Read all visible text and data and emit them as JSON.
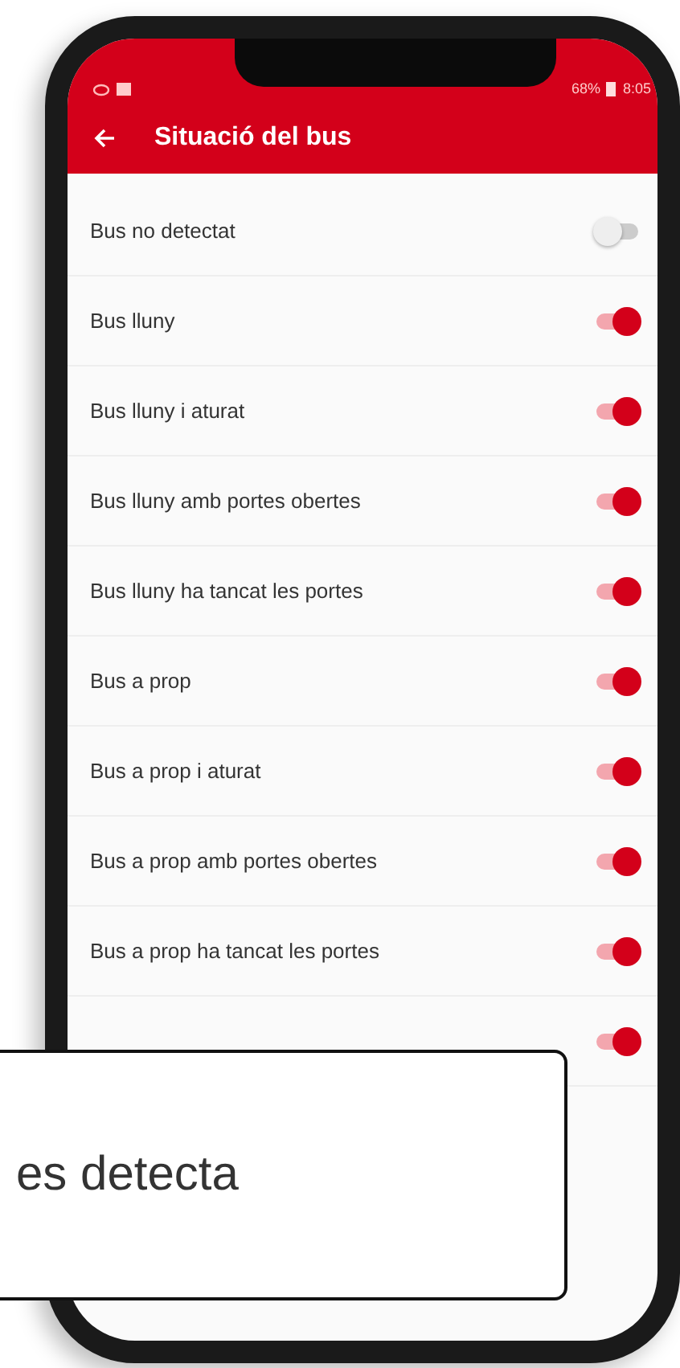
{
  "status_bar": {
    "battery": "68%",
    "time": "8:05"
  },
  "app_bar": {
    "title": "Situació del bus"
  },
  "rows": [
    {
      "label": "Bus no detectat",
      "on": false
    },
    {
      "label": "Bus lluny",
      "on": true
    },
    {
      "label": "Bus lluny i aturat",
      "on": true
    },
    {
      "label": "Bus lluny amb portes obertes",
      "on": true
    },
    {
      "label": "Bus lluny ha tancat les portes",
      "on": true
    },
    {
      "label": "Bus a prop",
      "on": true
    },
    {
      "label": "Bus a prop i aturat",
      "on": true
    },
    {
      "label": "Bus a prop amb portes obertes",
      "on": true
    },
    {
      "label": "Bus a prop ha tancat les portes",
      "on": true
    },
    {
      "on": true
    }
  ],
  "callout": {
    "text": "es detecta"
  }
}
